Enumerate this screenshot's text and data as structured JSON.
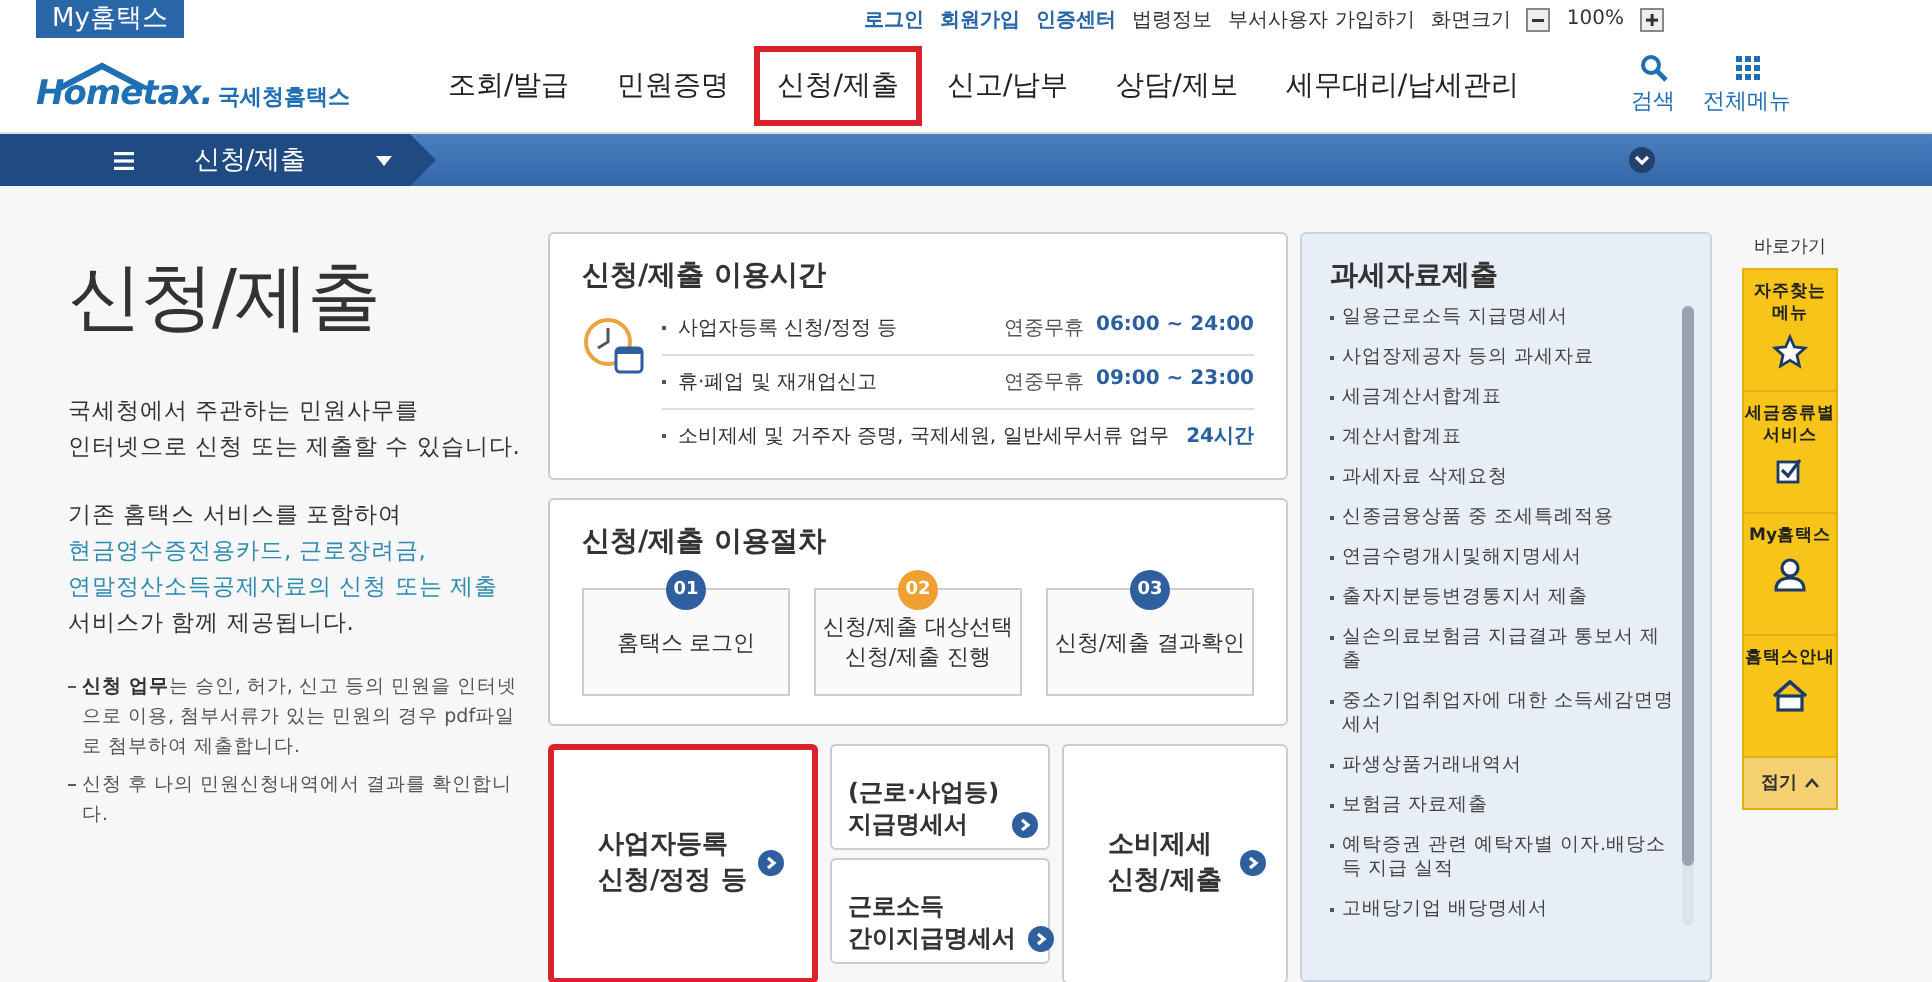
{
  "top_bar": {
    "brand": "My홈택스",
    "links": [
      {
        "label": "로그인",
        "kind": "strong"
      },
      {
        "label": "회원가입",
        "kind": "strong"
      },
      {
        "label": "인증센터",
        "kind": "strong"
      },
      {
        "label": "법령정보",
        "kind": "plain"
      },
      {
        "label": "부서사용자 가입하기",
        "kind": "plain"
      }
    ],
    "zoom": {
      "label": "화면크기",
      "value": "100%"
    }
  },
  "header": {
    "logo": {
      "word": "Hometax.",
      "name": "국세청홈택스"
    },
    "nav": [
      {
        "label": "조회/발급",
        "highlighted": false
      },
      {
        "label": "민원증명",
        "highlighted": false
      },
      {
        "label": "신청/제출",
        "highlighted": true
      },
      {
        "label": "신고/납부",
        "highlighted": false
      },
      {
        "label": "상담/제보",
        "highlighted": false
      },
      {
        "label": "세무대리/납세관리",
        "highlighted": false
      }
    ],
    "tools": [
      {
        "label": "검색",
        "kind": "search"
      },
      {
        "label": "전체메뉴",
        "kind": "grid"
      }
    ]
  },
  "menu_bar": {
    "label": "신청/제출"
  },
  "intro": {
    "title": "신청/제출",
    "paragraphs": [
      [
        {
          "text": "국세청에서 주관하는 민원사무를",
          "kind": "plain"
        },
        {
          "text": "인터넷으로 신청 또는 제출할 수 있습니다.",
          "kind": "plain"
        }
      ],
      [
        {
          "text": "기존 홈택스 서비스를 포함하여",
          "kind": "plain"
        },
        {
          "text": "현금영수증전용카드, 근로장려금,",
          "kind": "link"
        },
        {
          "text": "연말정산소득공제자료의 신청 또는 제출",
          "kind": "link"
        },
        {
          "text": "서비스가 함께 제공됩니다.",
          "kind": "plain"
        }
      ]
    ],
    "notes": [
      "**신청 업무**는 승인, 허가, 신고 등의 민원을 인터넷으로 이용, 첨부서류가 있는 민원의 경우 pdf파일로 첨부하여 제출합니다.",
      "신청 후 나의 민원신청내역에서 결과를 확인합니다."
    ]
  },
  "hours": {
    "title": "신청/제출 이용시간",
    "rows": [
      {
        "label": "사업자등록 신청/정정 등",
        "note": "연중무휴",
        "time": "06:00 ~ 24:00"
      },
      {
        "label": "휴·폐업 및 재개업신고",
        "note": "연중무휴",
        "time": "09:00 ~ 23:00"
      },
      {
        "label": "소비제세 및 거주자 증명, 국제세원, 일반세무서류 업무",
        "time": "24시간"
      }
    ]
  },
  "procedure": {
    "title": "신청/제출 이용절차",
    "steps": [
      {
        "number": "01",
        "color": "#2f5f9e",
        "lines": [
          "홈택스 로그인"
        ]
      },
      {
        "number": "02",
        "color": "#f0a030",
        "lines": [
          "신청/제출 대상선택",
          "신청/제출 진행"
        ]
      },
      {
        "number": "03",
        "color": "#2f5f9e",
        "lines": [
          "신청/제출 결과확인"
        ]
      }
    ]
  },
  "shortcuts": [
    {
      "lines": [
        "사업자등록",
        "신청/정정 등"
      ],
      "highlighted": true
    },
    {
      "lines": [
        "(근로·사업등)",
        "지급명세서"
      ],
      "highlighted": false
    },
    {
      "lines": [
        "근로소득",
        "간이지급명세서"
      ],
      "highlighted": false
    },
    {
      "lines": [
        "소비제세",
        "신청/제출"
      ],
      "highlighted": false
    }
  ],
  "tax_data": {
    "title": "과세자료제출",
    "items": [
      "일용근로소득 지급명세서",
      "사업장제공자 등의 과세자료",
      "세금계산서합계표",
      "계산서합계표",
      "과세자료 삭제요청",
      "신종금융상품 중 조세특례적용",
      "연금수령개시및해지명세서",
      "출자지분등변경통지서 제출",
      "실손의료보험금 지급결과 통보서 제출",
      "중소기업취업자에 대한 소득세감면명세서",
      "파생상품거래내역서",
      "보험금 자료제출",
      "예탁증권 관련 예탁자별 이자.배당소득 지급 실적",
      "고배당기업 배당명세서"
    ]
  },
  "quick": {
    "title": "바로가기",
    "items": [
      {
        "lines": [
          "자주찾는",
          "메뉴"
        ],
        "kind": "star"
      },
      {
        "lines": [
          "세금종류별",
          "서비스"
        ],
        "kind": "check"
      },
      {
        "lines": [
          "My홈택스"
        ],
        "kind": "person"
      },
      {
        "lines": [
          "홈택스안내"
        ],
        "kind": "house"
      }
    ],
    "collapse": "접기"
  }
}
